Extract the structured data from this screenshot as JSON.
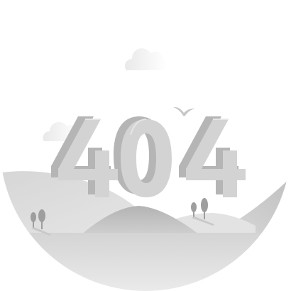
{
  "illustration": {
    "code": "404",
    "icons": {
      "clouds": "cloud-icon",
      "bird": "bird-icon",
      "trees": "tree-icon"
    },
    "colors": {
      "background": "#ffffff",
      "digit_face": "#d3d3d3",
      "digit_side": "#b5b5b5",
      "digit_top": "#e6e6e6",
      "hill_light": "#e2e2e2",
      "hill_mid": "#bdbdbd",
      "ground": "#d8d8d8"
    }
  }
}
